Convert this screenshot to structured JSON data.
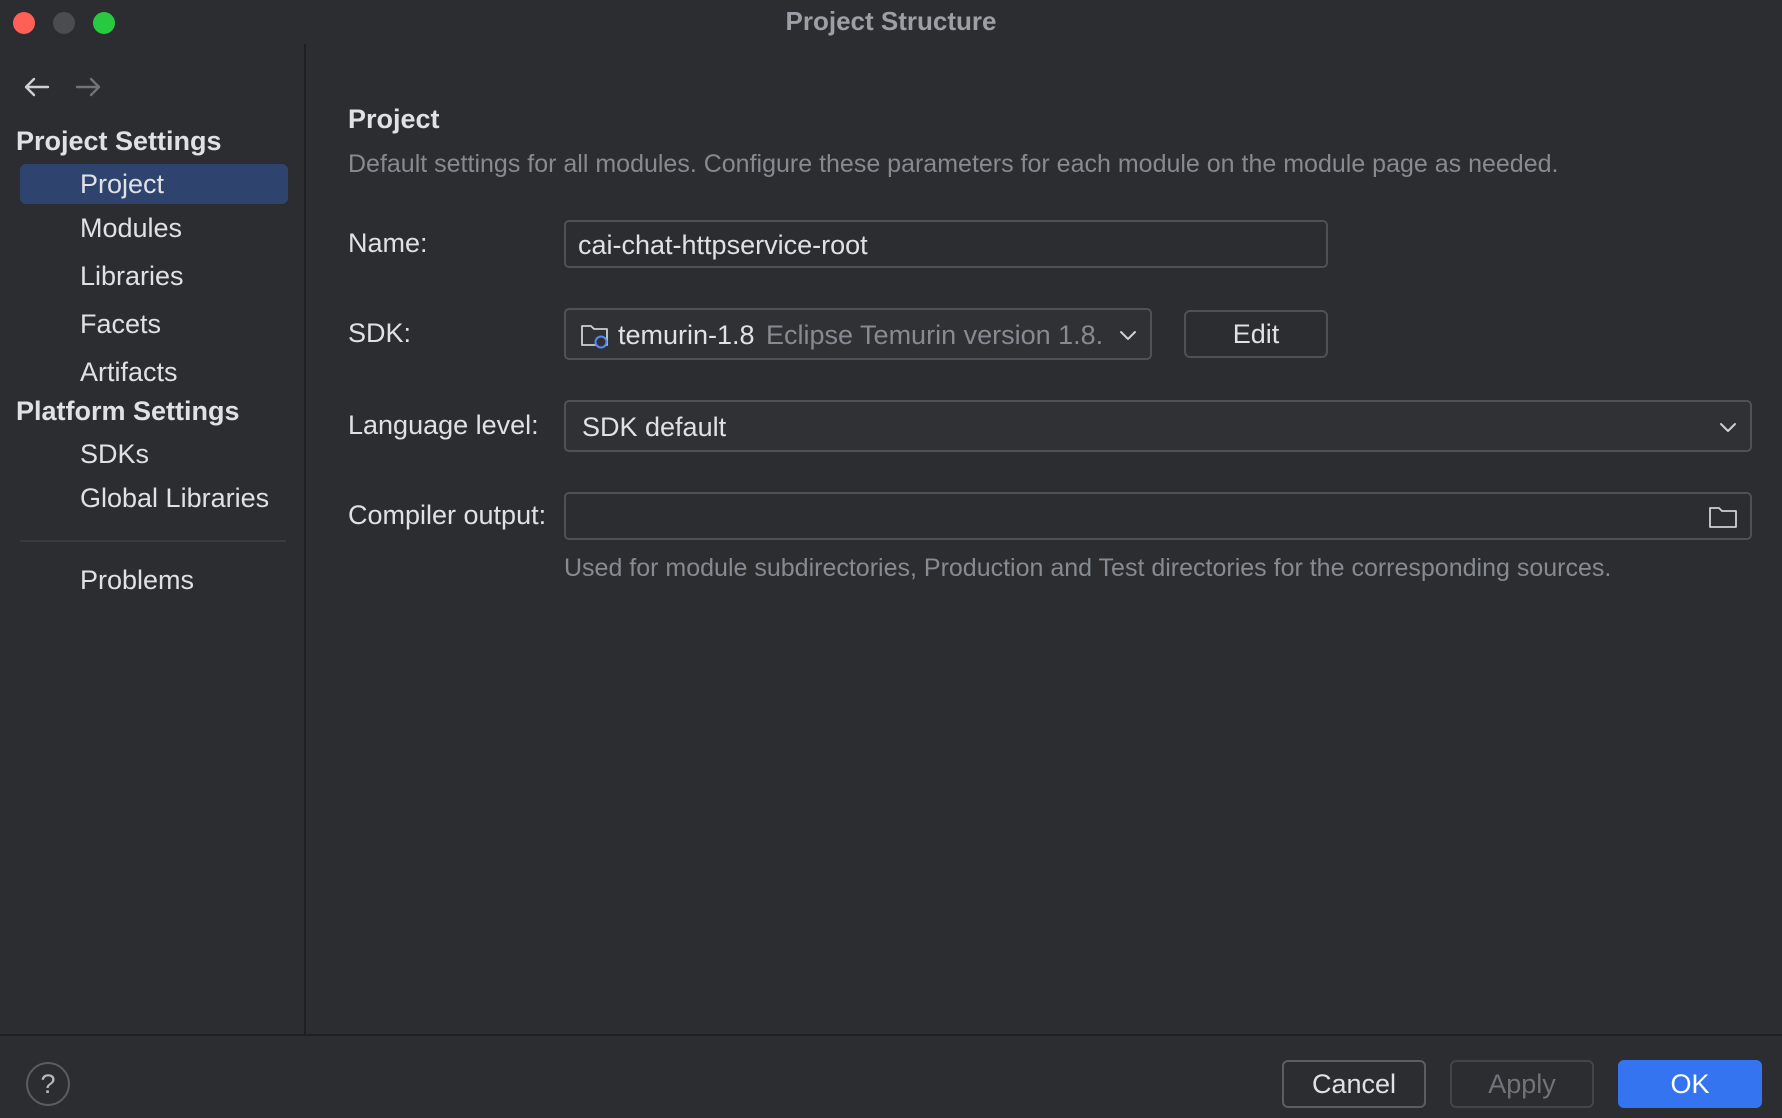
{
  "window": {
    "title": "Project Structure"
  },
  "sidebar": {
    "groups": [
      {
        "title": "Project Settings",
        "items": [
          "Project",
          "Modules",
          "Libraries",
          "Facets",
          "Artifacts"
        ]
      },
      {
        "title": "Platform Settings",
        "items": [
          "SDKs",
          "Global Libraries"
        ]
      }
    ],
    "problems_label": "Problems",
    "selected": "Project"
  },
  "main": {
    "heading": "Project",
    "description": "Default settings for all modules. Configure these parameters for each module on the module page as needed.",
    "name": {
      "label": "Name:",
      "value": "cai-chat-httpservice-root"
    },
    "sdk": {
      "label": "SDK:",
      "name": "temurin-1.8",
      "detail": "Eclipse Temurin version 1.8.",
      "edit_label": "Edit"
    },
    "language_level": {
      "label": "Language level:",
      "value": "SDK default"
    },
    "compiler_output": {
      "label": "Compiler output:",
      "value": "",
      "hint": "Used for module subdirectories, Production and Test directories for the corresponding sources."
    }
  },
  "footer": {
    "help_label": "?",
    "cancel_label": "Cancel",
    "apply_label": "Apply",
    "ok_label": "OK"
  },
  "colors": {
    "accent": "#3574f0",
    "selection": "#2e436e",
    "background": "#2b2d30"
  }
}
